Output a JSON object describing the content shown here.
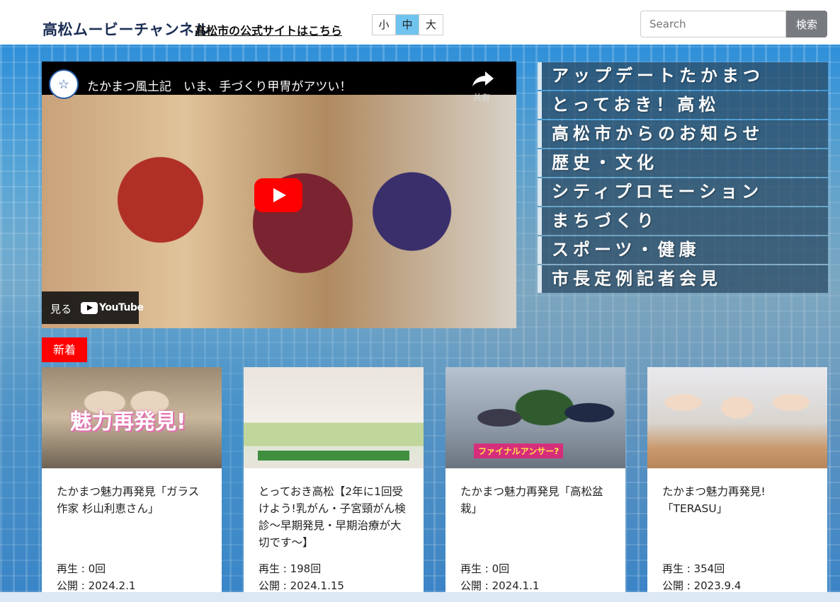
{
  "header": {
    "site_title": "高松ムービーチャンネル",
    "official_link": "高松市の公式サイトはこちら",
    "font_sizes": [
      {
        "label": "小",
        "active": false
      },
      {
        "label": "中",
        "active": true
      },
      {
        "label": "大",
        "active": false
      }
    ],
    "search": {
      "placeholder": "Search",
      "button_label": "検索"
    }
  },
  "video": {
    "title": "たかまつ風土記　いま、手づくり甲冑がアツい！",
    "share_label": "共有",
    "watch_label": "見る",
    "youtube_label": "YouTube"
  },
  "categories": [
    "アップデートたかまつ",
    "とっておき！高松",
    "高松市からのお知らせ",
    "歴史・文化",
    "シティプロモーション",
    "まちづくり",
    "スポーツ・健康",
    "市長定例記者会見"
  ],
  "new_badge": "新着",
  "cards": [
    {
      "title": "たかまつ魅力再発見「ガラス作家 杉山利恵さん」",
      "plays": "再生 : 0回",
      "published": "公開 : 2024.2.1",
      "thumb_text": "魅力再発見!"
    },
    {
      "title": "とっておき高松【2年に1回受けよう!乳がん・子宮頸がん検診～早期発見・早期治療が大切です～】",
      "plays": "再生 : 198回",
      "published": "公開 : 2024.1.15"
    },
    {
      "title": "たかまつ魅力再発見「高松盆栽」",
      "plays": "再生 : 0回",
      "published": "公開 : 2024.1.1",
      "thumb_text": "ファイナルアンサー?"
    },
    {
      "title": "たかまつ魅力再発見!「TERASU」",
      "plays": "再生 : 354回",
      "published": "公開 : 2023.9.4"
    }
  ],
  "colors": {
    "title": "#1c2f55",
    "active_size": "#6fc3ef",
    "badge": "#ff0000",
    "search_button": "#777b80"
  }
}
